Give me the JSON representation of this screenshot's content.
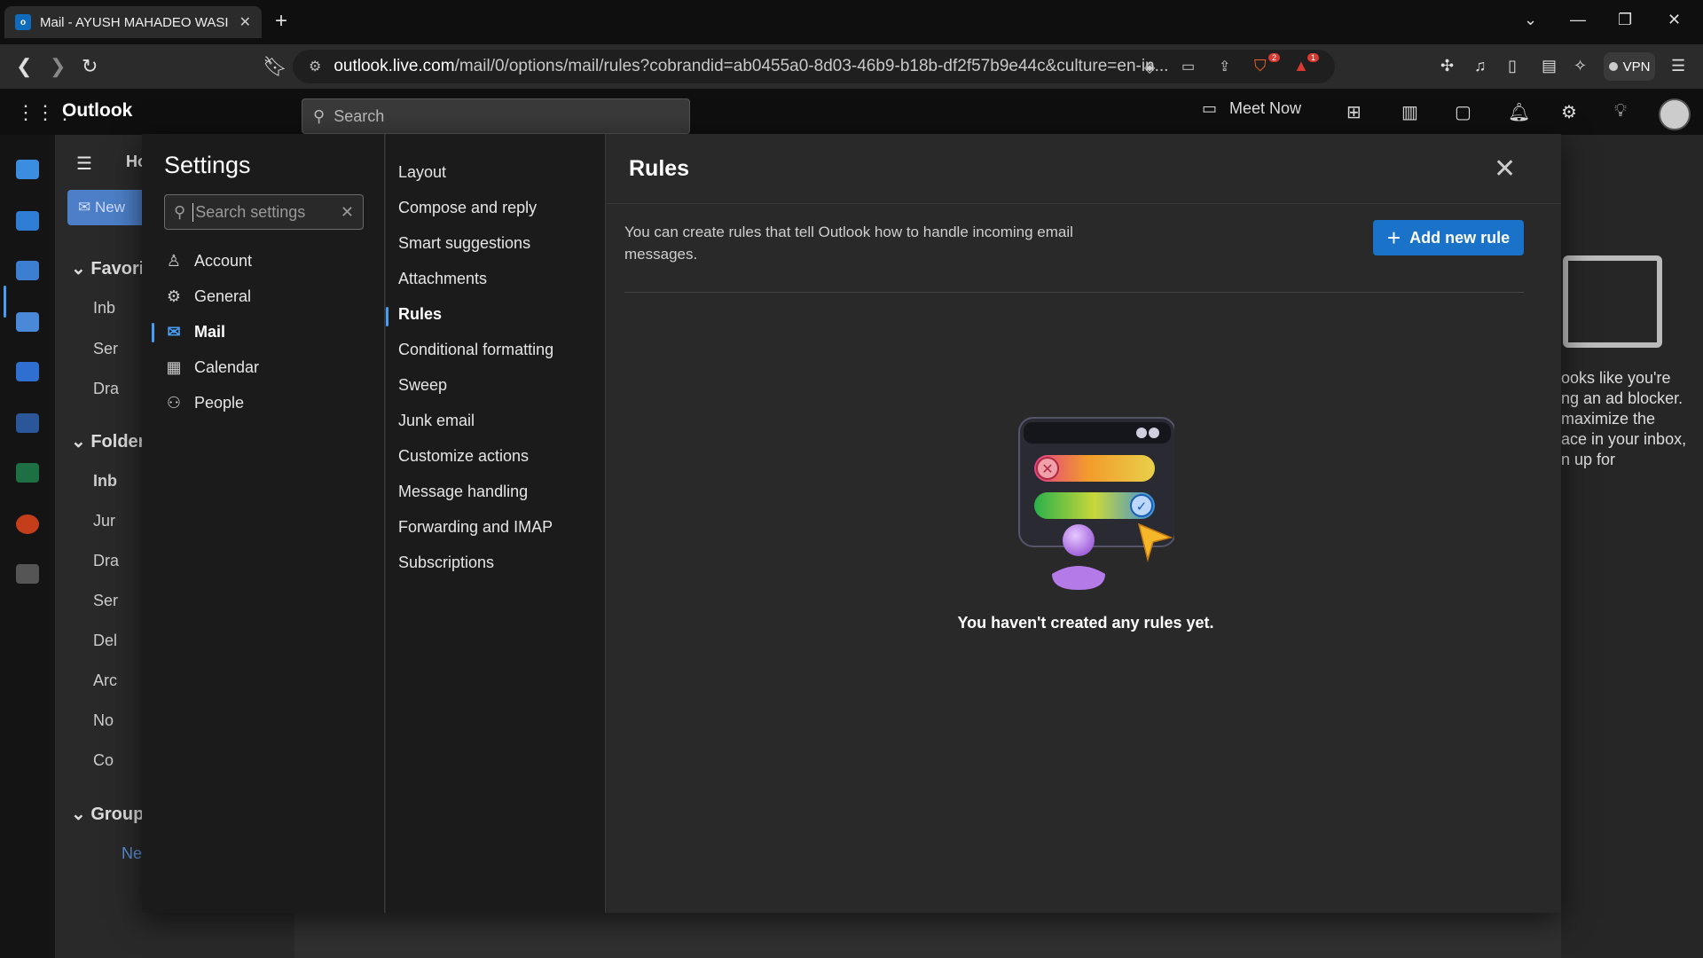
{
  "browser": {
    "tab_title": "Mail - AYUSH MAHADEO WASI",
    "tab_icon": "outlook-favicon",
    "url_host": "outlook.live.com",
    "url_path": "/mail/0/options/mail/rules?cobrandid=ab0455a0-8d03-46b9-b18b-df2f57b9e44c&culture=en-in...",
    "vpn_label": "VPN",
    "shield_badge": "2",
    "alert_badge": "1"
  },
  "header": {
    "app_name": "Outlook",
    "search_placeholder": "Search",
    "meet_now": "Meet Now"
  },
  "folder_pane": {
    "home_tab": "Ho",
    "new_mail": "New",
    "favorites_head": "Favori",
    "fav_items": [
      "Inb",
      "Ser",
      "Dra"
    ],
    "folders_head": "Folder",
    "folder_items": [
      "Inb",
      "Jur",
      "Dra",
      "Ser",
      "Del",
      "Arc",
      "No",
      "Co"
    ],
    "groups_head": "Group",
    "groups_new": "Ne"
  },
  "background_right": {
    "lines": [
      "ooks like you're",
      "ng an ad blocker.",
      "maximize the",
      "ace in your inbox,",
      "n up for"
    ]
  },
  "settings": {
    "title": "Settings",
    "search_placeholder": "Search settings",
    "categories": [
      {
        "label": "Account",
        "icon": "person-icon"
      },
      {
        "label": "General",
        "icon": "gear-icon"
      },
      {
        "label": "Mail",
        "icon": "mail-icon"
      },
      {
        "label": "Calendar",
        "icon": "calendar-icon"
      },
      {
        "label": "People",
        "icon": "people-icon"
      }
    ],
    "active_category": "Mail",
    "subcategories": [
      "Layout",
      "Compose and reply",
      "Smart suggestions",
      "Attachments",
      "Rules",
      "Conditional formatting",
      "Sweep",
      "Junk email",
      "Customize actions",
      "Message handling",
      "Forwarding and IMAP",
      "Subscriptions"
    ],
    "active_subcategory": "Rules"
  },
  "rules": {
    "title": "Rules",
    "description": "You can create rules that tell Outlook how to handle incoming email messages.",
    "add_button": "Add new rule",
    "empty_message": "You haven't created any rules yet."
  },
  "colors": {
    "accent": "#479ef5",
    "button": "#1a73c8",
    "dialog_bg": "#292929",
    "nav_bg": "#1b1b1b"
  }
}
